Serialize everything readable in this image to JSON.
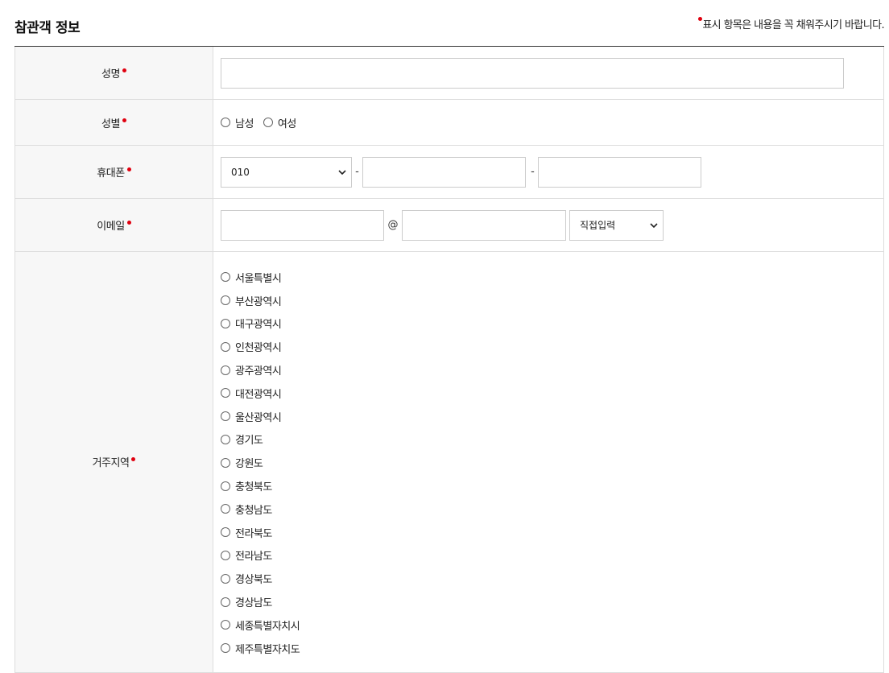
{
  "section_title": "참관객 정보",
  "required_note": "표시 항목은 내용을 꼭 채워주시기 바랍니다.",
  "fields": {
    "name": {
      "label": "성명",
      "value": ""
    },
    "gender": {
      "label": "성별",
      "options": [
        "남성",
        "여성"
      ]
    },
    "phone": {
      "label": "휴대폰",
      "prefix_selected": "010",
      "separator": "-",
      "middle": "",
      "last": ""
    },
    "email": {
      "label": "이메일",
      "local": "",
      "at": "@",
      "domain": "",
      "domain_select": "직접입력"
    },
    "region": {
      "label": "거주지역",
      "options": [
        "서울특별시",
        "부산광역시",
        "대구광역시",
        "인천광역시",
        "광주광역시",
        "대전광역시",
        "울산광역시",
        "경기도",
        "강원도",
        "충청북도",
        "충청남도",
        "전라북도",
        "전라남도",
        "경상북도",
        "경상남도",
        "세종특별자치시",
        "제주특별자치도"
      ]
    }
  },
  "colors": {
    "required_dot": "#e0000f",
    "label_bg": "#f7f7f7",
    "border": "#dddddd"
  },
  "icons": {
    "select_arrow": "chevron-down-icon",
    "required": "required-dot-icon"
  }
}
